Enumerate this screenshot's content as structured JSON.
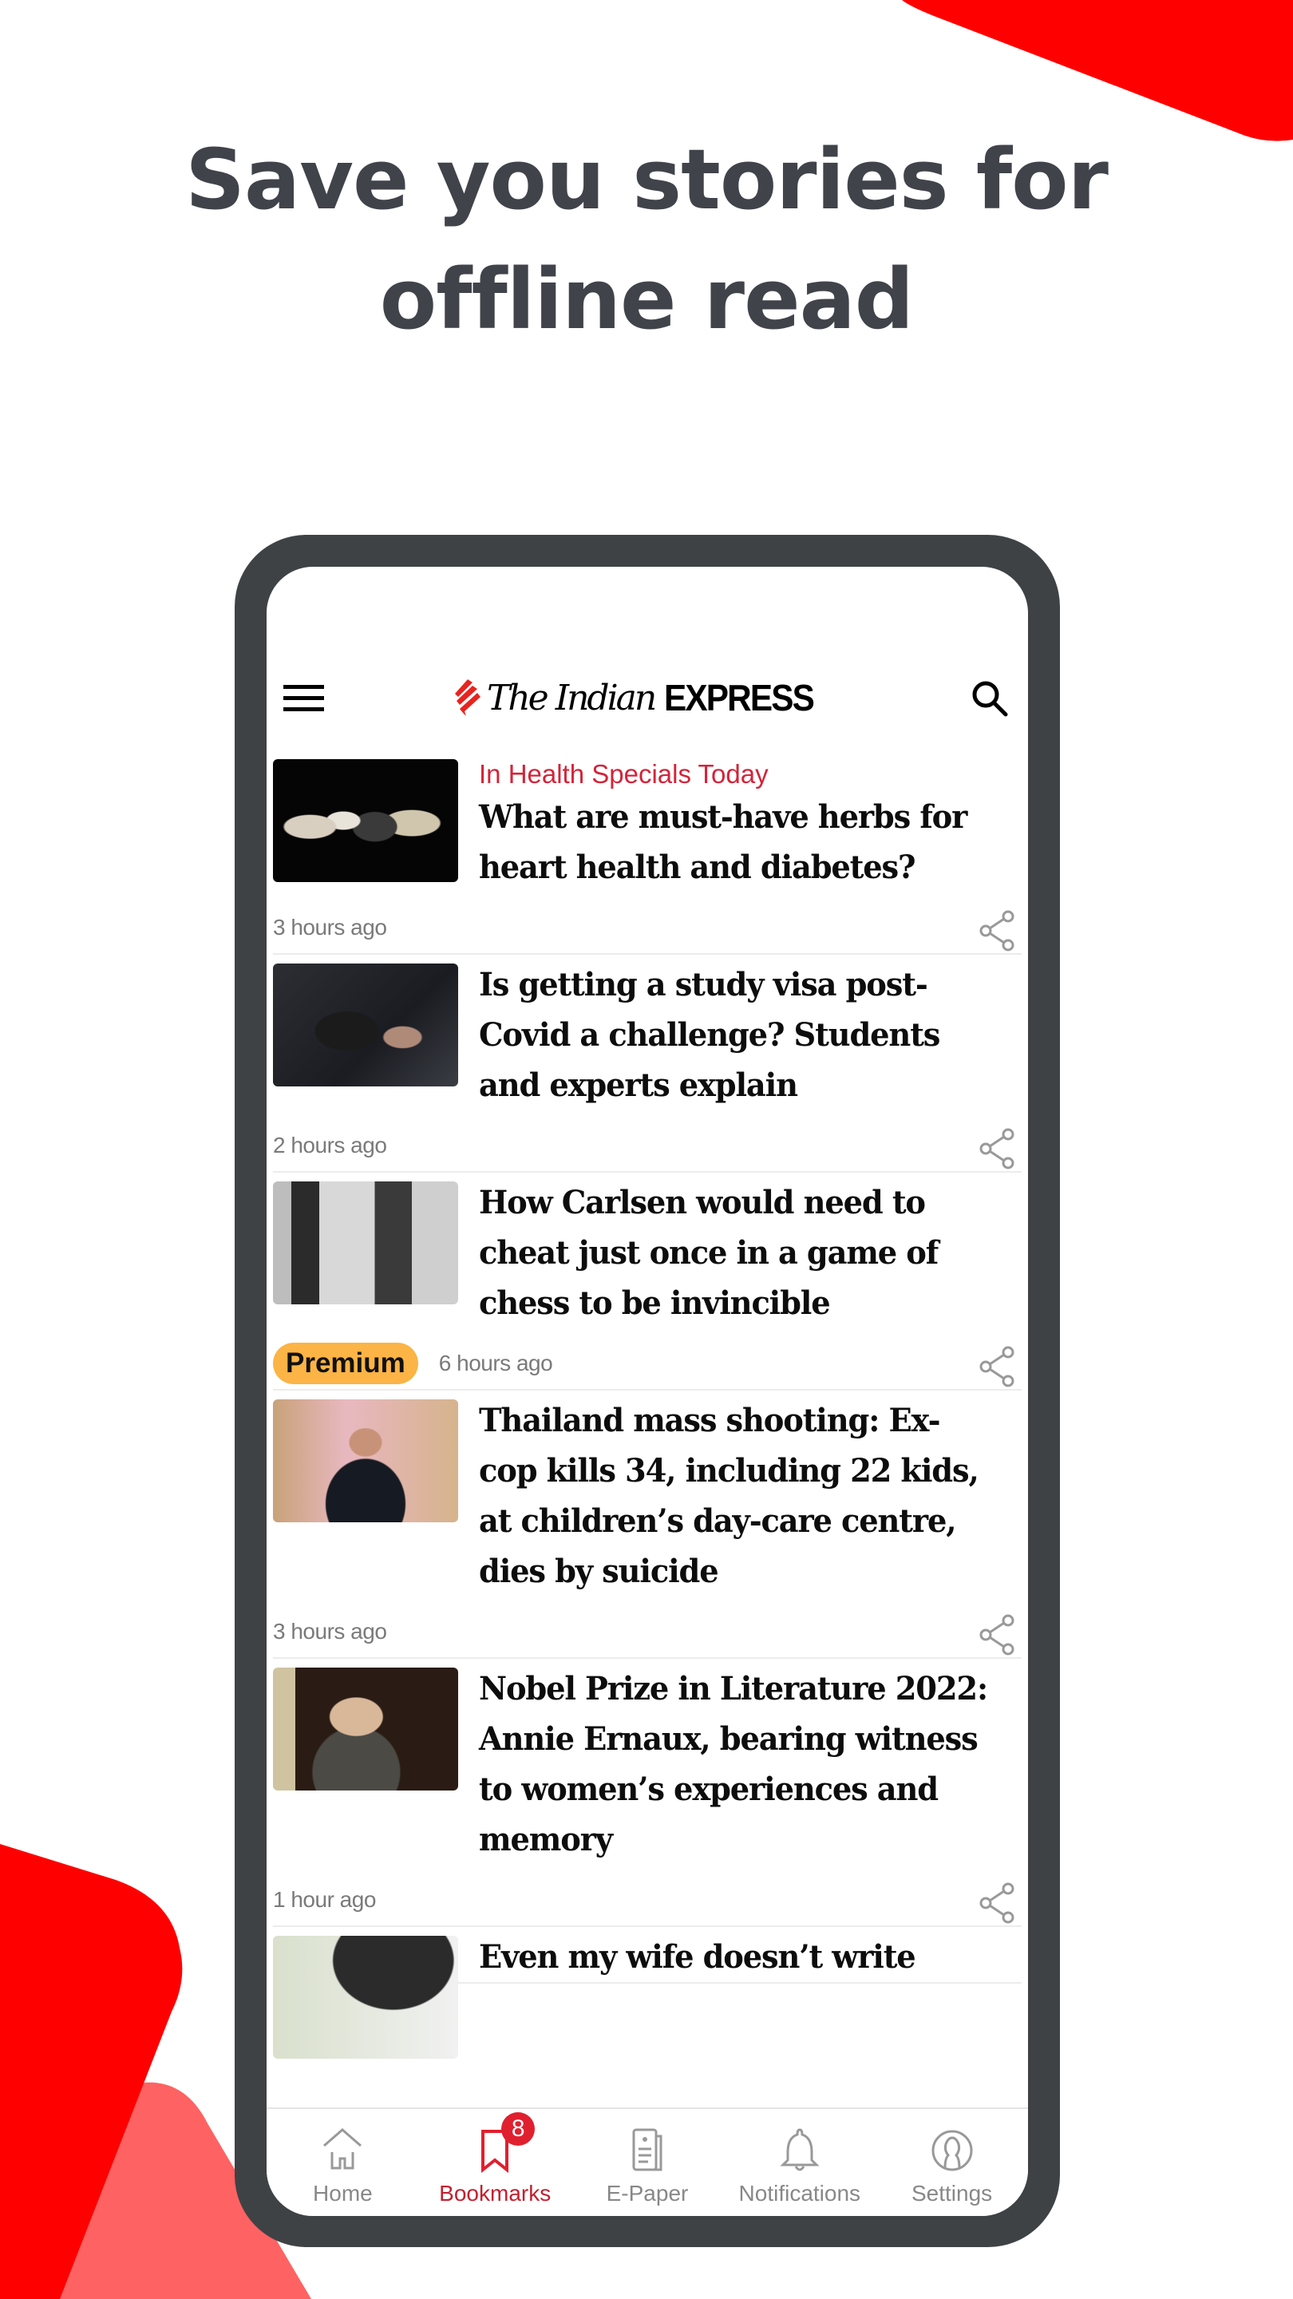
{
  "promo": {
    "title_line1": "Save you stories for",
    "title_line2": "offline read",
    "accent_red": "#ff0000",
    "accent_red_light": "#ff6262"
  },
  "app": {
    "logo_serif": "The Indian",
    "logo_sans": "EXPRESS",
    "menu_icon": "hamburger-icon",
    "search_icon": "search-icon"
  },
  "articles": [
    {
      "category": "In Health Specials Today",
      "title": "What are must-have herbs for heart health and diabetes?",
      "time": "3 hours ago",
      "premium": false,
      "thumb": "tea-bags-image"
    },
    {
      "category": "",
      "title": "Is getting a study visa post-Covid a challenge? Students and experts explain",
      "time": "2 hours ago",
      "premium": false,
      "thumb": "passport-image"
    },
    {
      "category": "",
      "title": "How Carlsen would need to cheat just once in a game of chess to be invincible",
      "time": "6 hours ago",
      "premium": true,
      "premium_label": "Premium",
      "thumb": "chess-players-image"
    },
    {
      "category": "",
      "title": "Thailand mass shooting: Ex-cop kills 34, including 22 kids, at children’s day-care centre, dies by suicide",
      "time": "3 hours ago",
      "premium": false,
      "thumb": "thai-police-image"
    },
    {
      "category": "",
      "title": "Nobel Prize in Literature 2022: Annie Ernaux, bearing witness to women’s experiences and memory",
      "time": "1 hour ago",
      "premium": false,
      "thumb": "annie-ernaux-image"
    },
    {
      "category": "",
      "title": "Even my wife doesn’t write",
      "time": "",
      "premium": false,
      "thumb": "umbrella-image"
    }
  ],
  "bottom_nav": {
    "items": [
      {
        "label": "Home",
        "icon": "home-icon",
        "active": false
      },
      {
        "label": "Bookmarks",
        "icon": "bookmark-icon",
        "active": true,
        "badge": "8"
      },
      {
        "label": "E-Paper",
        "icon": "epaper-icon",
        "active": false
      },
      {
        "label": "Notifications",
        "icon": "bell-icon",
        "active": false
      },
      {
        "label": "Settings",
        "icon": "settings-icon",
        "active": false
      }
    ]
  }
}
